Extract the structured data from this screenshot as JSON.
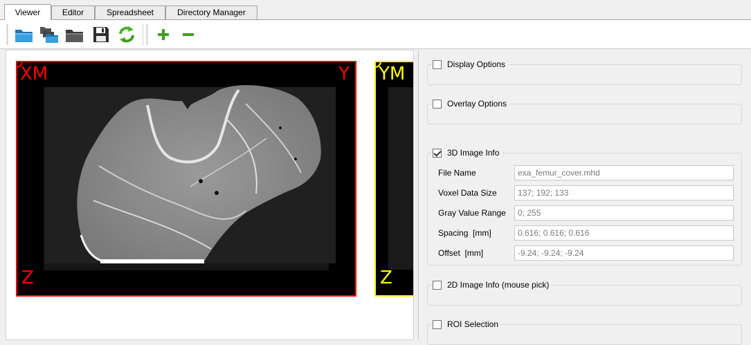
{
  "tabs": [
    {
      "label": "Viewer",
      "active": true
    },
    {
      "label": "Editor"
    },
    {
      "label": "Spreadsheet"
    },
    {
      "label": "Directory Manager"
    }
  ],
  "toolbar": {
    "icons": [
      "open-folder-icon",
      "open-multiple-folders-icon",
      "close-folder-icon",
      "save-icon",
      "refresh-icon",
      "zoom-in-icon",
      "zoom-out-icon"
    ]
  },
  "views": {
    "xm": {
      "top_left": "XM",
      "top_right": "Y",
      "bottom_left": "Z",
      "color": "#ff0000"
    },
    "ym": {
      "top_left": "YM",
      "bottom_left": "Z",
      "color": "#ffff00"
    }
  },
  "panel": {
    "display_options": {
      "label": "Display Options",
      "checked": false
    },
    "overlay_options": {
      "label": "Overlay Options",
      "checked": false
    },
    "image_info_3d": {
      "label": "3D Image Info",
      "checked": true,
      "rows": [
        {
          "label": "File Name",
          "value": "exa_femur_cover.mhd"
        },
        {
          "label": "Voxel Data Size",
          "value": "137; 192; 133"
        },
        {
          "label": "Gray Value Range",
          "value": "0; 255"
        },
        {
          "label": "Spacing  [mm]",
          "value": "0.616; 0.616; 0.616"
        },
        {
          "label": "Offset  [mm]",
          "value": "-9.24; -9.24; -9.24"
        }
      ]
    },
    "image_info_2d": {
      "label": "2D Image Info (mouse pick)",
      "checked": false
    },
    "roi_selection": {
      "label": "ROI Selection",
      "checked": false
    }
  }
}
